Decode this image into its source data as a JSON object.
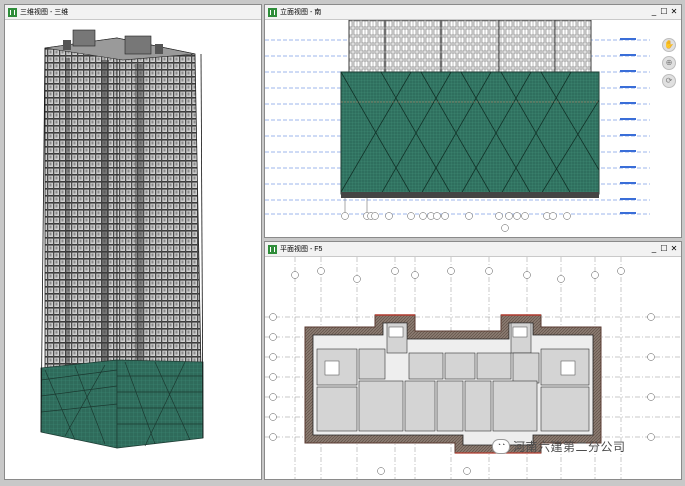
{
  "panes": {
    "view3d": {
      "title": "三维视图 - 三维",
      "controls": {
        "minimize": "_",
        "restore": "☐",
        "close": "✕"
      }
    },
    "elevation": {
      "title": "立面视图 - 南",
      "controls": {
        "minimize": "_",
        "restore": "☐",
        "close": "✕"
      }
    },
    "plan": {
      "title": "平面视图 - F5",
      "controls": {
        "minimize": "_",
        "restore": "☐",
        "close": "✕"
      }
    }
  },
  "navbar": {
    "items": [
      {
        "icon": "pan-icon",
        "glyph": "✋"
      },
      {
        "icon": "zoom-icon",
        "glyph": "⊕"
      },
      {
        "icon": "orbit-icon",
        "glyph": "⟳"
      }
    ]
  },
  "watermark": {
    "icon": "wechat-icon",
    "glyph": "◔◔",
    "text": "河南六建第二分公司"
  },
  "colors": {
    "scaffold_mesh": "#2e6a5a",
    "building_gray": "#5c5c5c",
    "axis_line": "#3a6ed8",
    "wall_red": "#b03a2e"
  }
}
